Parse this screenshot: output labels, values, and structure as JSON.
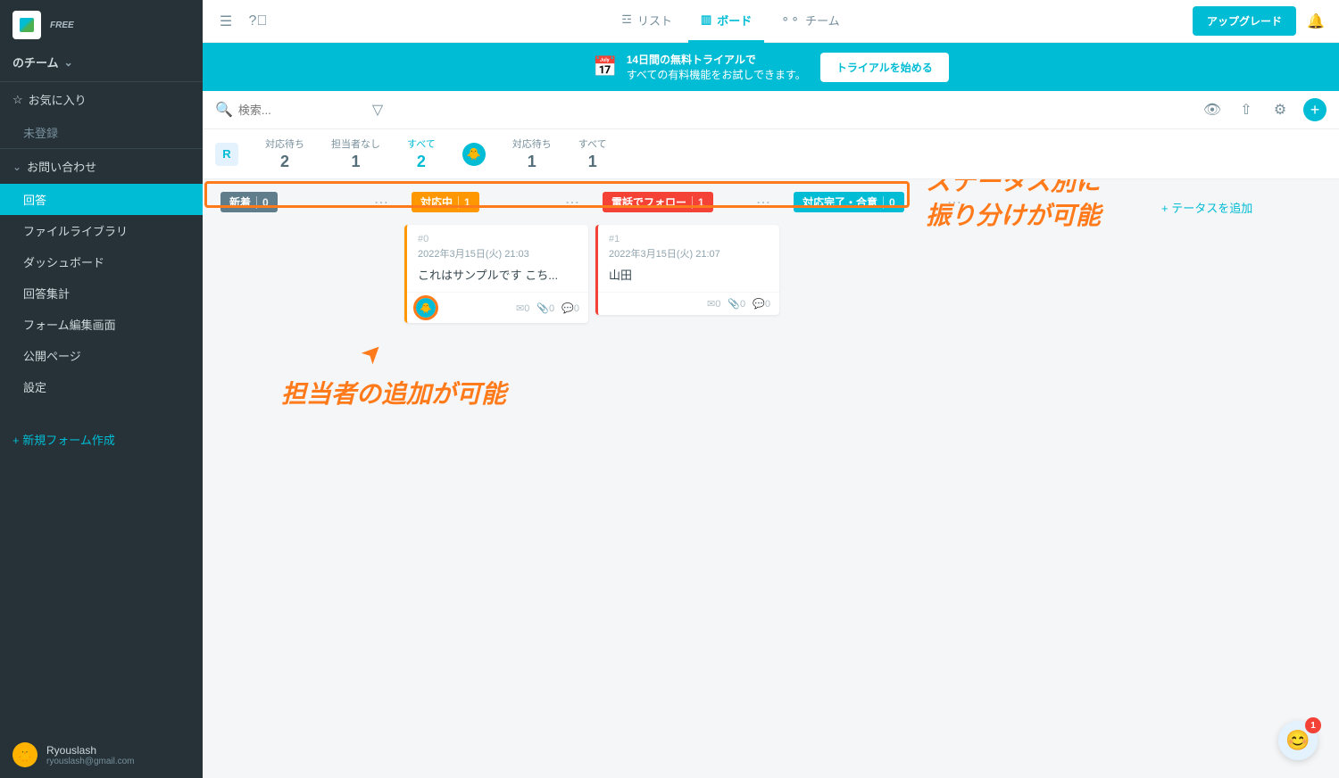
{
  "sidebar": {
    "free_badge": "FREE",
    "team_name": "のチーム",
    "favorites": {
      "header": "お気に入り",
      "empty": "未登録"
    },
    "sections": [
      {
        "header": "お問い合わせ",
        "items": [
          "回答",
          "ファイルライブラリ",
          "ダッシュボード",
          "回答集計",
          "フォーム編集画面",
          "公開ページ",
          "設定"
        ],
        "active_index": 0
      }
    ],
    "new_form": "+ 新規フォーム作成",
    "user": {
      "name": "Ryouslash",
      "email": "ryouslash@gmail.com"
    }
  },
  "topbar": {
    "views": [
      {
        "label": "リスト",
        "icon": "list-icon"
      },
      {
        "label": "ボード",
        "icon": "board-icon"
      },
      {
        "label": "チーム",
        "icon": "team-icon"
      }
    ],
    "active_view": 1,
    "upgrade": "アップグレード"
  },
  "trial": {
    "line1": "14日間の無料トライアルで",
    "line2": "すべての有料機能をお試しできます。",
    "button": "トライアルを始める"
  },
  "search": {
    "placeholder": "検索..."
  },
  "filters": [
    {
      "avatar": "R",
      "label": "対応待ち",
      "count": "2"
    },
    {
      "avatar": "",
      "label": "担当者なし",
      "count": "1"
    },
    {
      "avatar": "",
      "label": "すべて",
      "count": "2",
      "active": true
    },
    {
      "avatar": "🐥",
      "label": "対応待ち",
      "count": "1",
      "teal": true
    },
    {
      "avatar": "",
      "label": "すべて",
      "count": "1"
    }
  ],
  "columns": [
    {
      "name": "新着",
      "count": "0",
      "color": "gray",
      "cards": []
    },
    {
      "name": "対応中",
      "count": "1",
      "color": "orange",
      "cards": [
        {
          "id": "#0",
          "date": "2022年3月15日(火) 21:03",
          "title": "これはサンプルです こち...",
          "mail": "0",
          "attach": "0",
          "comment": "0",
          "assignee": true
        }
      ]
    },
    {
      "name": "電話でフォロー",
      "count": "1",
      "color": "red",
      "cards": [
        {
          "id": "#1",
          "date": "2022年3月15日(火) 21:07",
          "title": "山田",
          "mail": "0",
          "attach": "0",
          "comment": "0",
          "assignee": false
        }
      ]
    },
    {
      "name": "対応完了・合意",
      "count": "0",
      "color": "teal",
      "cards": []
    }
  ],
  "add_status": "テータスを追加",
  "annotations": {
    "right": "ステータス別に\n振り分けが可能",
    "bottom": "担当者の追加が可能"
  },
  "chat_badge": "1"
}
